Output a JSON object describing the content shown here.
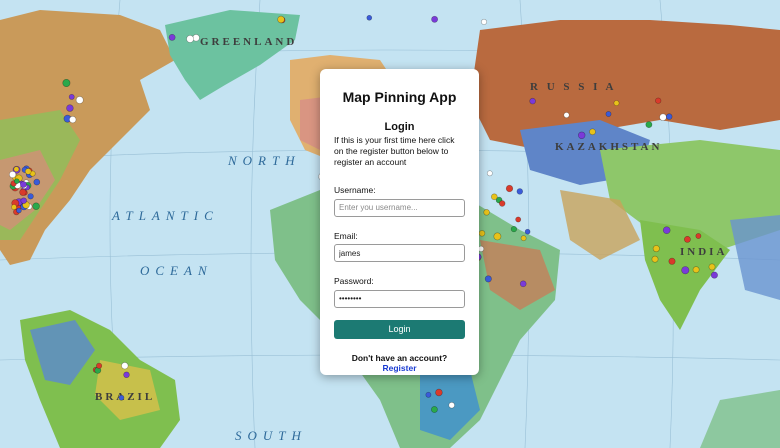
{
  "map": {
    "ocean_labels": [
      "NORTH",
      "ATLANTIC",
      "OCEAN",
      "SOUTH"
    ],
    "region_labels": [
      "GREENLAND",
      "R U S S I A",
      "KAZAKHSTAN",
      "INDIA",
      "BRAZIL"
    ]
  },
  "login_card": {
    "app_title": "Map Pinning App",
    "section_title": "Login",
    "intro_text": "If this is your first time here click on the register button below to register an account",
    "username": {
      "label": "Username:",
      "placeholder": "Enter you username...",
      "value": ""
    },
    "email": {
      "label": "Email:",
      "value": "james"
    },
    "password": {
      "label": "Password:",
      "value": "••••••••"
    },
    "login_button_label": "Login",
    "register_prompt": "Don't have an account?",
    "register_link": "Register"
  },
  "colors": {
    "accent": "#1c7a73",
    "link": "#1a3bd1",
    "ocean": "#bfe0f0"
  }
}
